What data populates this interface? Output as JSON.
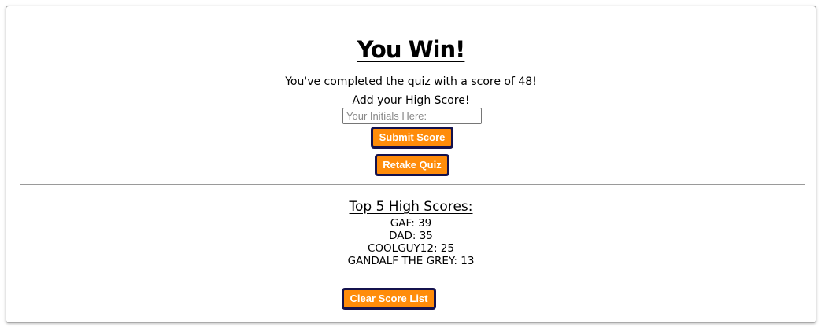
{
  "result": {
    "title": "You Win!",
    "score_message": "You've completed the quiz with a score of 48!",
    "add_label": "Add your High Score!"
  },
  "form": {
    "initials_value": "",
    "initials_placeholder": "Your Initials Here:",
    "submit_label": "Submit Score",
    "retake_label": "Retake Quiz"
  },
  "high_scores": {
    "title": "Top 5 High Scores:",
    "entries": [
      "GAF: 39",
      "DAD: 35",
      "COOLGUY12: 25",
      "GANDALF THE GREY: 13"
    ],
    "clear_label": "Clear Score List"
  },
  "colors": {
    "button_bg": "#ff8c0a",
    "button_border": "#14124d",
    "button_text": "#ffffff"
  }
}
